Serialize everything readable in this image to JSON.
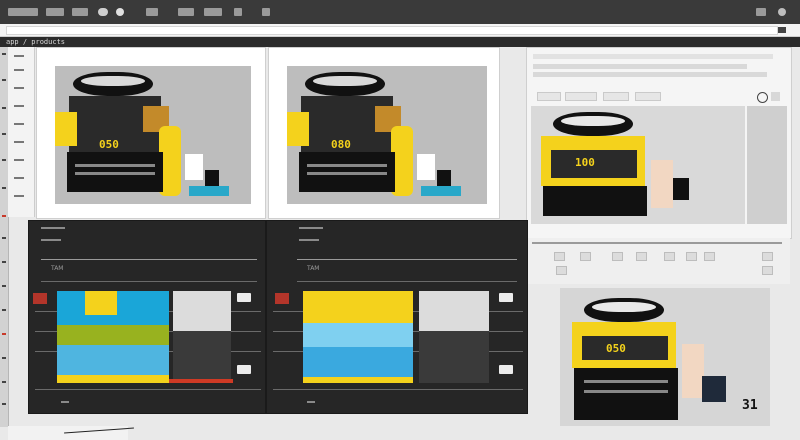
{
  "app": {
    "path_label": "app / products"
  },
  "cards": {
    "card1_value": "050",
    "card2_value": "080",
    "card3_value": "100",
    "card4_value": "050",
    "big_number": "31"
  },
  "panels": {
    "left_tag": "TAM",
    "right_tag": "TAM"
  },
  "colors": {
    "accent_yellow": "#f4d21c",
    "accent_blue": "#1aa6d8",
    "accent_green": "#98b21f",
    "accent_red": "#cf3a25",
    "dark_panel": "#262626"
  },
  "icons": [
    "menu-icon",
    "settings-icon",
    "refresh-icon",
    "close-icon",
    "search-icon"
  ]
}
